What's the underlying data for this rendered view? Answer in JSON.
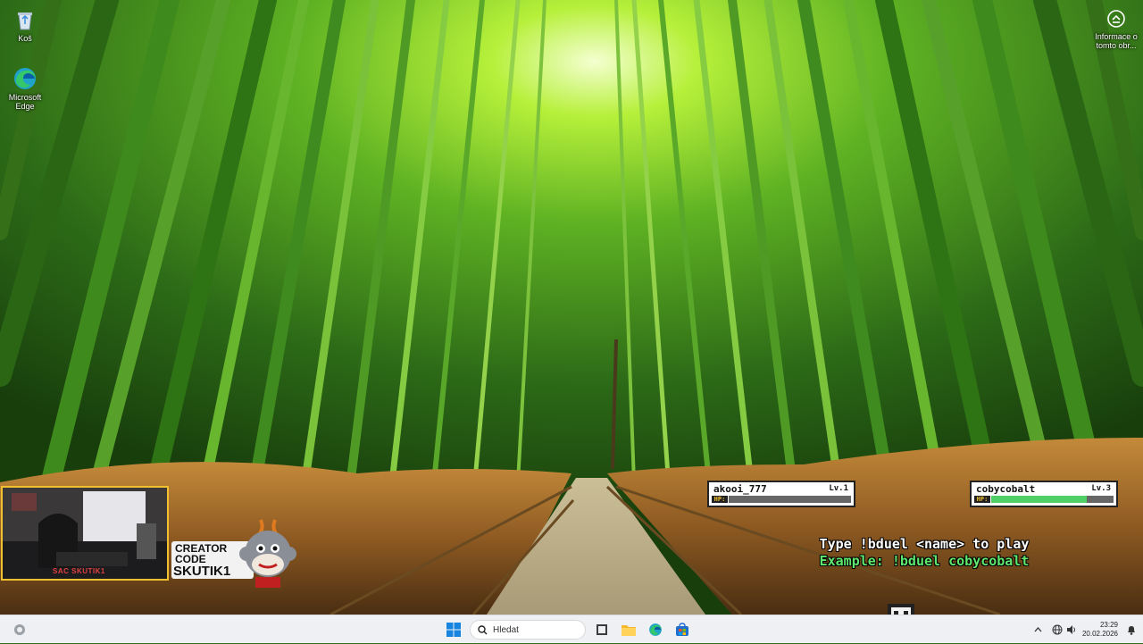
{
  "desktop": {
    "icons": [
      {
        "label": "Koš",
        "icon": "recycle-bin-icon"
      },
      {
        "label": "Microsoft Edge",
        "icon": "edge-icon"
      }
    ],
    "info_widget": {
      "label": "Informace o tomto obr...",
      "icon": "camera-info-icon"
    }
  },
  "overlay": {
    "webcam_caption": "SAC SKUTIK1",
    "creator_line1": "CREATOR",
    "creator_line2": "CODE",
    "creator_code": "SKUTIK1"
  },
  "duel": {
    "players": [
      {
        "name": "akooi_777",
        "level": "Lv.1",
        "hp_label": "HP:",
        "hp_fraction": 0.0
      },
      {
        "name": "cobycobalt",
        "level": "Lv.3",
        "hp_label": "HP:",
        "hp_fraction": 0.78
      }
    ],
    "instruction": "Type !bduel <name> to play",
    "example": "Example: !bduel cobycobalt",
    "hp_color": "#4fd066",
    "example_color": "#5fe86f"
  },
  "taskbar": {
    "search_placeholder": "Hledat",
    "pinned": [
      "start-icon",
      "search-icon",
      "task-view-icon",
      "file-explorer-icon",
      "edge-icon",
      "store-icon"
    ],
    "time": "23:29",
    "date": "20.02.2026",
    "accent": "#0078d4"
  }
}
